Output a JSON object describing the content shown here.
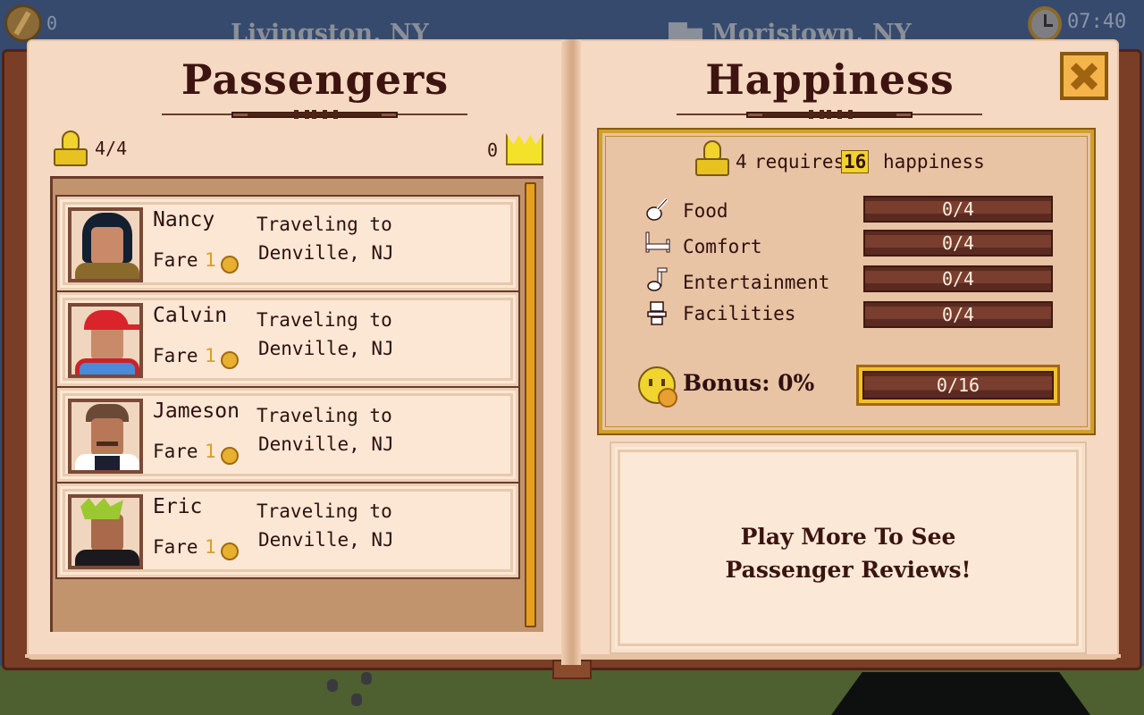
{
  "hud": {
    "coins": "0",
    "origin_city": "Livingston, NY",
    "destination_city": "Moristown, NY",
    "time": "07:40",
    "icons": {
      "coins": "coin-icon",
      "train": "train-icon",
      "clock": "pocket-watch-icon"
    }
  },
  "passengers_page": {
    "title": "Passengers",
    "capacity": "4/4",
    "vip_count": "0",
    "icons": {
      "capacity": "passenger-icon",
      "vip": "crown-icon"
    },
    "list": [
      {
        "name": "Nancy",
        "fare_label": "Fare",
        "fare": "1",
        "destination_line1": "Traveling to",
        "destination_line2": "Denville, NJ",
        "avatar": "woman-black-hair-brown-jacket"
      },
      {
        "name": "Calvin",
        "fare_label": "Fare",
        "fare": "1",
        "destination_line1": "Traveling to",
        "destination_line2": "Denville, NJ",
        "avatar": "boy-red-cap-backpack"
      },
      {
        "name": "Jameson",
        "fare_label": "Fare",
        "fare": "1",
        "destination_line1": "Traveling to",
        "destination_line2": "Denville, NJ",
        "avatar": "man-mustache-vest"
      },
      {
        "name": "Eric",
        "fare_label": "Fare",
        "fare": "1",
        "destination_line1": "Traveling to",
        "destination_line2": "Denville, NJ",
        "avatar": "green-mohawk-punk"
      }
    ]
  },
  "happiness_page": {
    "title": "Happiness",
    "close_label": "close",
    "requirement": {
      "passengers": "4",
      "text_mid": "requires",
      "amount": "16",
      "text_end": "happiness"
    },
    "categories": [
      {
        "label": "Food",
        "value": "0/4",
        "current": 0,
        "max": 4,
        "icon": "drumstick-icon"
      },
      {
        "label": "Comfort",
        "value": "0/4",
        "current": 0,
        "max": 4,
        "icon": "bed-icon"
      },
      {
        "label": "Entertainment",
        "value": "0/4",
        "current": 0,
        "max": 4,
        "icon": "music-note-icon"
      },
      {
        "label": "Facilities",
        "value": "0/4",
        "current": 0,
        "max": 4,
        "icon": "toilet-icon"
      }
    ],
    "bonus": {
      "label": "Bonus: 0%",
      "value": "0/16",
      "current": 0,
      "max": 16
    },
    "reviews_message_line1": "Play More To See",
    "reviews_message_line2": "Passenger Reviews!"
  },
  "colors": {
    "sky": "#364a6e",
    "grass": "#4e5f30",
    "book_cover": "#7a3e26",
    "page": "#f6d9c2",
    "gold_accent": "#d2a02a",
    "bar_fill": "#7a3e2e",
    "text_dark": "#2e1010",
    "fare_gold": "#d7a02a"
  }
}
